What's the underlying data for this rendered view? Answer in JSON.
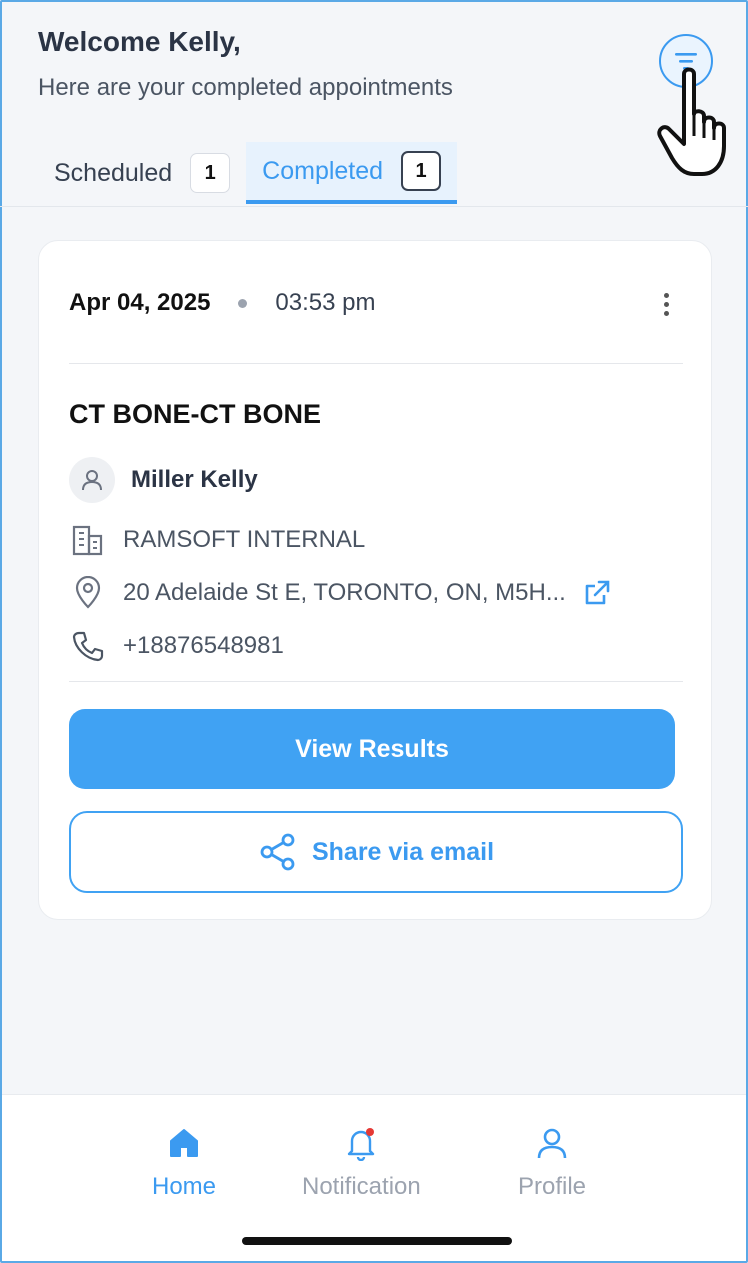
{
  "header": {
    "welcome": "Welcome Kelly,",
    "subtitle": "Here are your completed appointments"
  },
  "tabs": [
    {
      "label": "Scheduled",
      "count": "1",
      "active": false
    },
    {
      "label": "Completed",
      "count": "1",
      "active": true
    }
  ],
  "appointment": {
    "date": "Apr 04, 2025",
    "time": "03:53 pm",
    "procedure": "CT BONE-CT BONE",
    "patient": "Miller Kelly",
    "organization": "RAMSOFT INTERNAL",
    "address": "20 Adelaide St E, TORONTO, ON, M5H...",
    "phone": "+18876548981"
  },
  "actions": {
    "view_results": "View Results",
    "share_email": "Share via email"
  },
  "nav": {
    "home": "Home",
    "notification": "Notification",
    "profile": "Profile"
  },
  "colors": {
    "accent": "#40a2f3",
    "notification_dot": "#e53935"
  },
  "icons": [
    "filter-icon",
    "more-vertical-icon",
    "user-icon",
    "building-icon",
    "location-icon",
    "external-link-icon",
    "phone-icon",
    "share-icon",
    "home-icon",
    "bell-icon",
    "profile-icon",
    "hand-pointer-icon"
  ]
}
